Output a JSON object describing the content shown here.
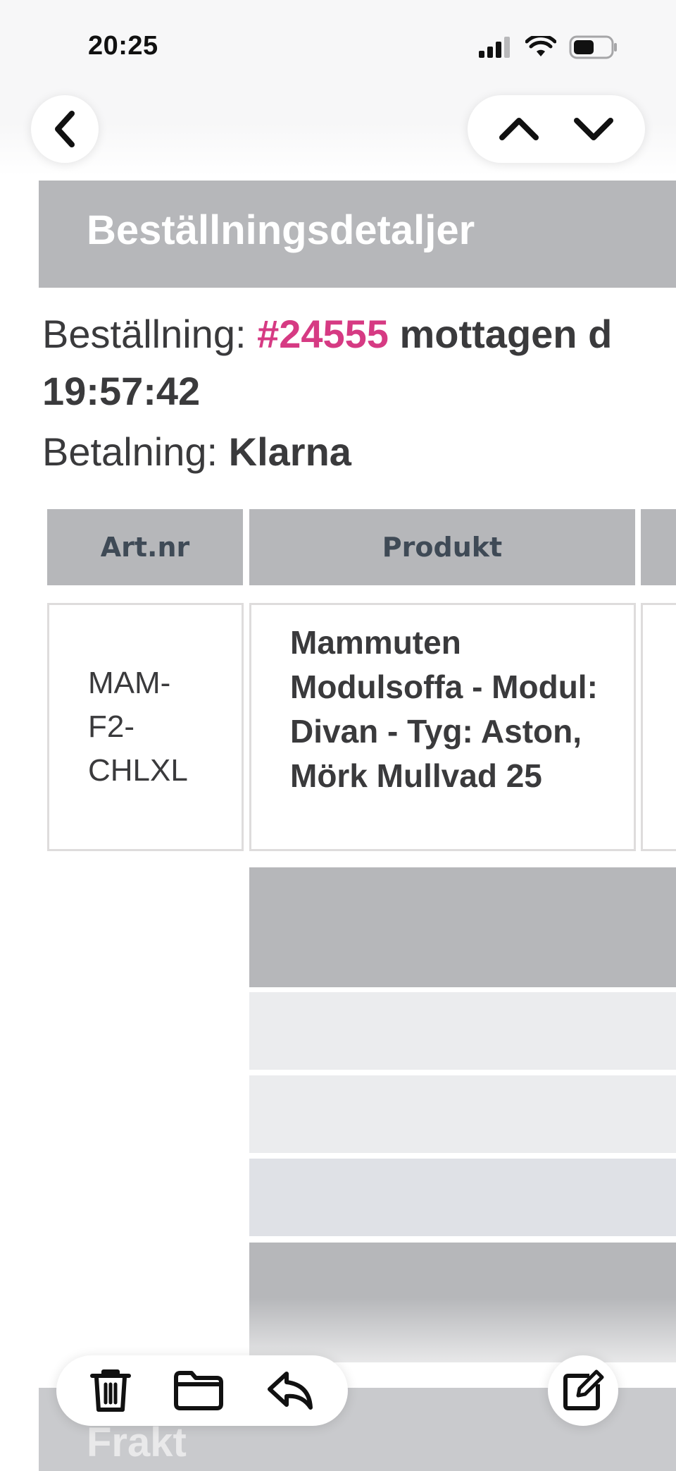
{
  "status_bar": {
    "time": "20:25"
  },
  "nav": {
    "back": "back",
    "prev": "previous",
    "next": "next"
  },
  "email": {
    "header_title": "Beställningsdetaljer",
    "order_label": "Beställning: ",
    "order_number": "#24555",
    "order_received": " mottagen d",
    "order_time": "19:57:42",
    "payment_label": "Betalning: ",
    "payment_method": "Klarna",
    "table": {
      "headers": [
        "Art.nr",
        "Produkt"
      ],
      "rows": [
        {
          "art_nr": "MAM-\nF2-\nCHLXL",
          "product": "Mammuten Modulsoffa - Modul: Divan - Tyg: Aston, Mörk Mullvad 25"
        }
      ]
    },
    "next_section_title": "Frakt"
  },
  "toolbar": {
    "icons": [
      "trash-icon",
      "folder-icon",
      "reply-icon",
      "compose-icon"
    ]
  },
  "colors": {
    "header_gray": "#b6b7ba",
    "order_number_pink": "#d63a83",
    "text_dark": "#3a3a3c"
  }
}
